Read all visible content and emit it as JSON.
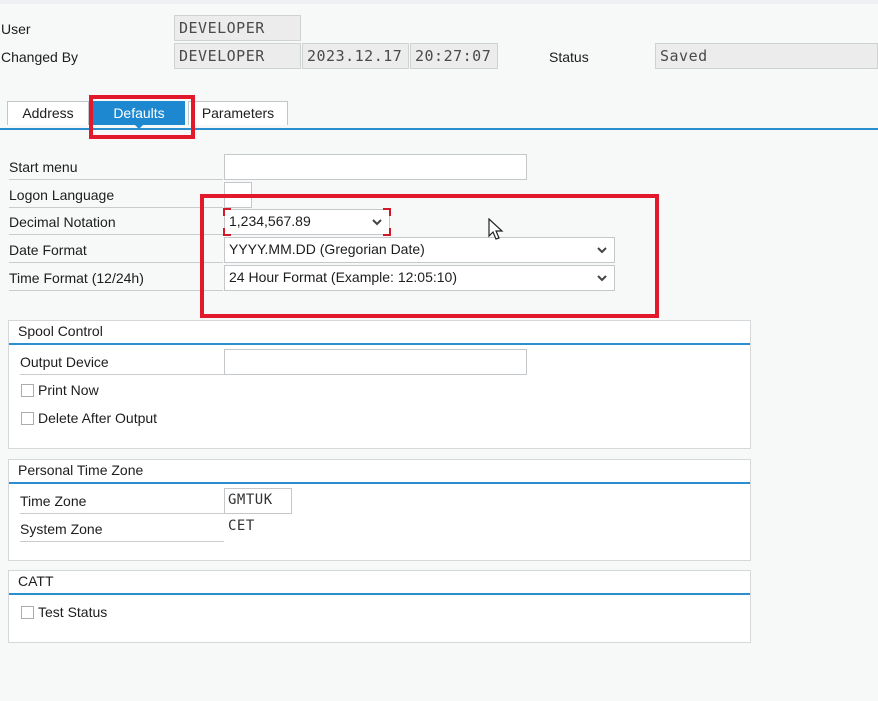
{
  "header": {
    "user_label": "User",
    "user_value": "DEVELOPER",
    "changed_by_label": "Changed By",
    "changed_by_value": "DEVELOPER",
    "changed_date": "2023.12.17",
    "changed_time": "20:27:07",
    "status_label": "Status",
    "status_value": "Saved"
  },
  "tabs": [
    {
      "label": "Address"
    },
    {
      "label": "Defaults"
    },
    {
      "label": "Parameters"
    }
  ],
  "defaults": {
    "start_menu_label": "Start menu",
    "start_menu_value": "",
    "logon_language_label": "Logon Language",
    "logon_language_value": "",
    "decimal_notation_label": "Decimal Notation",
    "decimal_notation_value": "1,234,567.89",
    "date_format_label": "Date Format",
    "date_format_value": "YYYY.MM.DD (Gregorian Date)",
    "time_format_label": "Time Format (12/24h)",
    "time_format_value": "24 Hour Format (Example: 12:05:10)"
  },
  "spool": {
    "title": "Spool Control",
    "output_device_label": "Output Device",
    "output_device_value": "",
    "print_now_label": "Print Now",
    "print_now_checked": false,
    "delete_after_output_label": "Delete After Output",
    "delete_after_output_checked": false
  },
  "timezone": {
    "title": "Personal Time Zone",
    "time_zone_label": "Time Zone",
    "time_zone_value": "GMTUK",
    "system_zone_label": "System Zone",
    "system_zone_value": "CET"
  },
  "catt": {
    "title": "CATT",
    "test_status_label": "Test Status",
    "test_status_checked": false
  },
  "icons": {
    "dropdown": "chevron-down-icon",
    "pointer": "mouse-cursor-icon"
  },
  "colors": {
    "accent": "#1d88d0",
    "highlight": "#e1192a"
  }
}
